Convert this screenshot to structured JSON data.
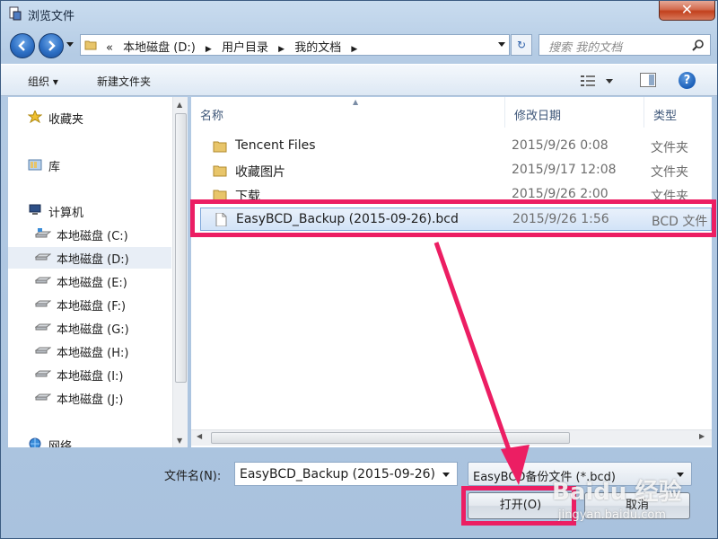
{
  "window": {
    "title": "浏览文件",
    "close_label": "✕"
  },
  "address": {
    "overflow": "«",
    "crumbs": [
      "本地磁盘 (D:)",
      "用户目录",
      "我的文档"
    ]
  },
  "search": {
    "placeholder": "搜索 我的文档"
  },
  "toolbar": {
    "organize_label": "组织 ▾",
    "new_folder_label": "新建文件夹",
    "help_label": "?"
  },
  "nav": {
    "favorites": "收藏夹",
    "libraries": "库",
    "computer": "计算机",
    "drives": [
      "本地磁盘 (C:)",
      "本地磁盘 (D:)",
      "本地磁盘 (E:)",
      "本地磁盘 (F:)",
      "本地磁盘 (G:)",
      "本地磁盘 (H:)",
      "本地磁盘 (I:)",
      "本地磁盘 (J:)"
    ],
    "network": "网络",
    "selected_drive": "本地磁盘 (D:)"
  },
  "columns": {
    "name": "名称",
    "date": "修改日期",
    "type": "类型"
  },
  "files": [
    {
      "name": "Tencent Files",
      "date": "2015/9/26 0:08",
      "type": "文件夹",
      "icon": "folder-icon"
    },
    {
      "name": "收藏图片",
      "date": "2015/9/17 12:08",
      "type": "文件夹",
      "icon": "folder-icon"
    },
    {
      "name": "下载",
      "date": "2015/9/26 2:00",
      "type": "文件夹",
      "icon": "folder-icon"
    },
    {
      "name": "EasyBCD_Backup (2015-09-26).bcd",
      "date": "2015/9/26 1:56",
      "type": "BCD 文件",
      "icon": "file-icon"
    }
  ],
  "bottom": {
    "filename_label": "文件名(N):",
    "filename_value": "EasyBCD_Backup (2015-09-26)",
    "filetype_value": "EasyBCD备份文件 (*.bcd)",
    "open_label": "打开(O)",
    "cancel_label": "取消"
  },
  "watermark": {
    "text": "Baidu 经验",
    "sub": "jingyan.baidu.com"
  },
  "colors": {
    "highlight": "#ec1e63",
    "selection": "#d2e3f7"
  }
}
